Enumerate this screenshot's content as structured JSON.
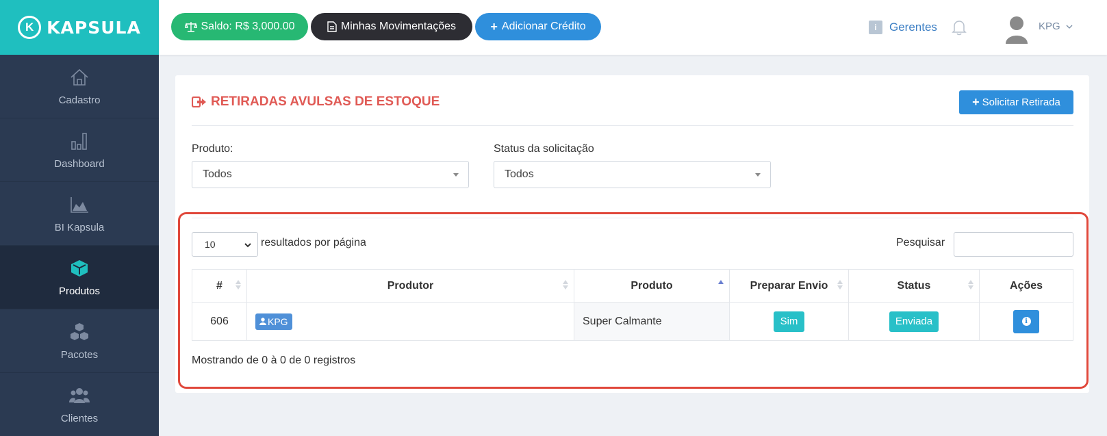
{
  "brand": {
    "logo_letter": "K",
    "name": "KAPSULA"
  },
  "sidebar": {
    "items": [
      {
        "label": "Cadastro",
        "icon": "home-icon"
      },
      {
        "label": "Dashboard",
        "icon": "bar-chart-icon"
      },
      {
        "label": "BI Kapsula",
        "icon": "area-chart-icon"
      },
      {
        "label": "Produtos",
        "icon": "cube-icon",
        "active": true
      },
      {
        "label": "Pacotes",
        "icon": "cubes-icon"
      },
      {
        "label": "Clientes",
        "icon": "users-icon"
      }
    ]
  },
  "topbar": {
    "saldo": "Saldo: R$ 3,000.00",
    "movimentacoes": "Minhas Movimentações",
    "adicionar": "Adicionar Crédito",
    "gerentes": "Gerentes",
    "user": "KPG"
  },
  "page": {
    "title": "RETIRADAS AVULSAS DE ESTOQUE",
    "solicitar_button": "Solicitar Retirada",
    "filter_produto_label": "Produto:",
    "filter_produto_value": "Todos",
    "filter_status_label": "Status da solicitação",
    "filter_status_value": "Todos"
  },
  "table": {
    "per_page_value": "10",
    "per_page_text": "resultados por página",
    "search_label": "Pesquisar",
    "headers": [
      "#",
      "Produtor",
      "Produto",
      "Preparar Envio",
      "Status",
      "Ações"
    ],
    "rows": [
      {
        "id": "606",
        "produtor": "KPG",
        "produto": "Super Calmante",
        "preparar": "Sim",
        "status": "Enviada"
      }
    ],
    "footer": "Mostrando de 0 à 0 de 0 registros"
  },
  "colors": {
    "accent": "#1fbfbf",
    "sidebar": "#2b3a52",
    "title": "#e05a55",
    "highlight": "#e0483b"
  }
}
